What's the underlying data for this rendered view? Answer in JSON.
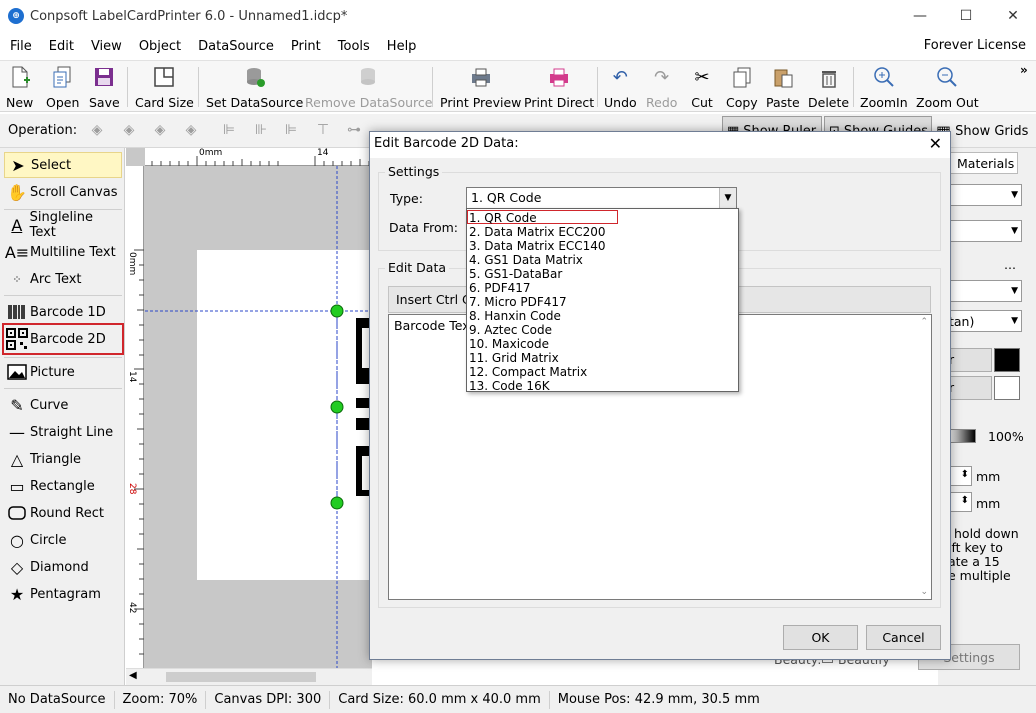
{
  "window": {
    "title": "Conpsoft LabelCardPrinter 6.0 - Unnamed1.idcp*",
    "minimize": "—",
    "maximize": "☐",
    "close": "✕"
  },
  "menu": {
    "items": [
      "File",
      "Edit",
      "View",
      "Object",
      "DataSource",
      "Print",
      "Tools",
      "Help"
    ],
    "license": "Forever License"
  },
  "toolbar": {
    "new": "New",
    "open": "Open",
    "save": "Save",
    "card_size": "Card Size",
    "set_datasource": "Set DataSource",
    "remove_datasource": "Remove DataSource",
    "print_preview": "Print Preview",
    "print_direct": "Print Direct",
    "undo": "Undo",
    "redo": "Redo",
    "cut": "Cut",
    "copy": "Copy",
    "paste": "Paste",
    "delete": "Delete",
    "zoomin": "ZoomIn",
    "zoomout": "Zoom Out",
    "more": "»"
  },
  "operation": {
    "label": "Operation:",
    "show_ruler": "Show Ruler",
    "show_guides": "Show Guides",
    "show_grids": "Show Grids"
  },
  "tools": {
    "select": "Select",
    "scroll_canvas": "Scroll Canvas",
    "singleline_text": "Singleline Text",
    "multiline_text": "Multiline Text",
    "arc_text": "Arc Text",
    "barcode_1d": "Barcode 1D",
    "barcode_2d": "Barcode 2D",
    "picture": "Picture",
    "curve": "Curve",
    "straight_line": "Straight Line",
    "triangle": "Triangle",
    "rectangle": "Rectangle",
    "round_rect": "Round Rect",
    "circle": "Circle",
    "diamond": "Diamond",
    "pentagram": "Pentagram"
  },
  "rulers": {
    "h0": "0mm",
    "h14": "14",
    "v0": "0mm",
    "v14": "14",
    "v28": "28",
    "v42": "42"
  },
  "right_panel": {
    "materials_tab": "Materials",
    "percent": "100%",
    "unit1": "mm",
    "unit2": "mm",
    "hint_lines": [
      "hold down",
      "ift key to",
      "ate a 15",
      "e multiple"
    ],
    "font_partial": "tan)",
    "r1": "r",
    "r2": "r",
    "beauty_label": "Beauty:",
    "beauty_check": "Beautify",
    "settings_btn": "Settings"
  },
  "status": {
    "datasource": "No DataSource",
    "zoom": "Zoom: 70%",
    "dpi": "Canvas DPI: 300",
    "card_size": "Card Size: 60.0 mm x 40.0 mm",
    "mouse_pos": "Mouse Pos: 42.9 mm, 30.5 mm"
  },
  "dialog": {
    "title": "Edit Barcode 2D Data:",
    "settings_group": "Settings",
    "type_label": "Type:",
    "type_value": "1.  QR Code",
    "data_from_label": "Data From:",
    "edit_data_group": "Edit Data",
    "insert_button": "Insert Ctrl Cl",
    "text_content": "Barcode Text",
    "ok": "OK",
    "cancel": "Cancel",
    "type_options": [
      "1.  QR Code",
      "2.  Data Matrix ECC200",
      "3.  Data Matrix ECC140",
      "4.  GS1 Data Matrix",
      "5.  GS1-DataBar",
      "6.  PDF417",
      "7.  Micro PDF417",
      "8.  Hanxin Code",
      "9.  Aztec Code",
      "10.  Maxicode",
      "11.  Grid Matrix",
      "12.  Compact Matrix",
      "13.  Code 16K"
    ]
  },
  "colors": {
    "accent_red": "#d0262c",
    "handle_green": "#22cc22",
    "select_bg": "#fff7c4"
  }
}
